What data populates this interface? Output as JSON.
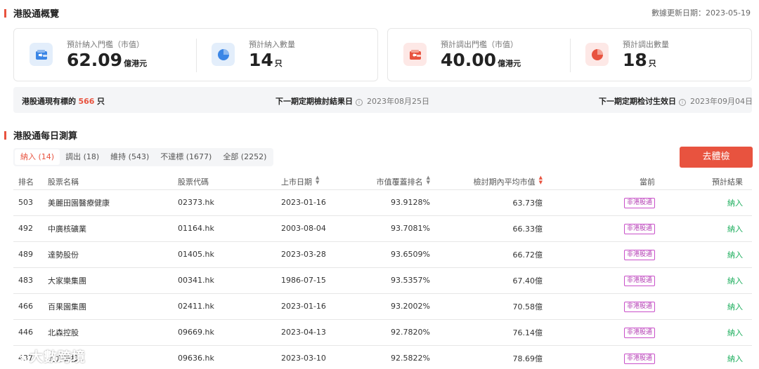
{
  "overview": {
    "title": "港股通概覽",
    "update_label": "數據更新日期：2023-05-19"
  },
  "stats": {
    "in_threshold": {
      "label": "預計納入門檻（市值）",
      "value": "62.09",
      "unit": "億港元",
      "icon": "wallet-in-icon"
    },
    "in_count": {
      "label": "預計納入數量",
      "value": "14",
      "unit": "只",
      "icon": "pie-chart-icon"
    },
    "out_threshold": {
      "label": "預計調出門檻（市值）",
      "value": "40.00",
      "unit": "億港元",
      "icon": "wallet-out-icon"
    },
    "out_count": {
      "label": "預計調出數量",
      "value": "18",
      "unit": "只",
      "icon": "pie-chart-icon"
    }
  },
  "infobar": {
    "current_label": "港股通現有標的",
    "current_count": "566",
    "current_unit": "只",
    "review_label": "下一期定期檢討結果日",
    "review_date": "2023年08月25日",
    "effective_label": "下一期定期检讨生效日",
    "effective_date": "2023年09月04日"
  },
  "daily": {
    "title": "港股通每日測算",
    "tabs": [
      "納入 (14)",
      "調出 (18)",
      "維持 (543)",
      "不達標 (1677)",
      "全部 (2252)"
    ],
    "active_tab": 0,
    "check_button": "去體檢"
  },
  "table": {
    "columns": [
      "排名",
      "股票名稱",
      "股票代碼",
      "上市日期",
      "市值覆蓋排名",
      "檢討期內平均市值",
      "當前",
      "預計結果"
    ],
    "rows": [
      {
        "rank": "503",
        "name": "美麗田園醫療健康",
        "code": "02373.hk",
        "date": "2023-01-16",
        "coverage": "93.9128%",
        "avg": "63.73億",
        "current": "非港股通",
        "result": "納入"
      },
      {
        "rank": "492",
        "name": "中廣核礦業",
        "code": "01164.hk",
        "date": "2003-08-04",
        "coverage": "93.7081%",
        "avg": "66.33億",
        "current": "非港股通",
        "result": "納入"
      },
      {
        "rank": "489",
        "name": "達勢股份",
        "code": "01405.hk",
        "date": "2023-03-28",
        "coverage": "93.6509%",
        "avg": "66.72億",
        "current": "非港股通",
        "result": "納入"
      },
      {
        "rank": "483",
        "name": "大家樂集團",
        "code": "00341.hk",
        "date": "1986-07-15",
        "coverage": "93.5357%",
        "avg": "67.40億",
        "current": "非港股通",
        "result": "納入"
      },
      {
        "rank": "466",
        "name": "百果園集團",
        "code": "02411.hk",
        "date": "2023-01-16",
        "coverage": "93.2002%",
        "avg": "70.58億",
        "current": "非港股通",
        "result": "納入"
      },
      {
        "rank": "446",
        "name": "北森控股",
        "code": "09669.hk",
        "date": "2023-04-13",
        "coverage": "92.7820%",
        "avg": "76.14億",
        "current": "非港股通",
        "result": "納入"
      },
      {
        "rank": "437",
        "name": "九方智投",
        "code": "09636.hk",
        "date": "2023-03-10",
        "coverage": "92.5822%",
        "avg": "78.69億",
        "current": "非港股通",
        "result": "納入"
      }
    ]
  },
  "watermark": {
    "text": "大數跨境"
  },
  "colors": {
    "accent": "#e8533f",
    "positive": "#1aad5b",
    "badge": "#c94fc9"
  }
}
